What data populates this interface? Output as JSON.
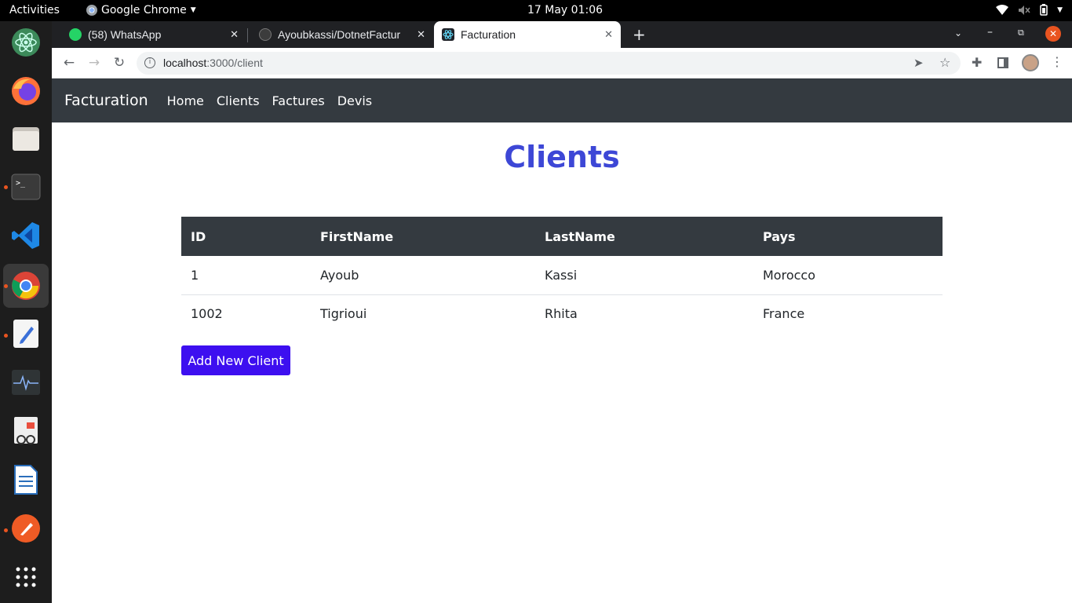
{
  "topbar": {
    "activities": "Activities",
    "app_name": "Google Chrome",
    "clock": "17 May  01:06"
  },
  "tabs": [
    {
      "title": "(58) WhatsApp",
      "favicon": "whatsapp-icon"
    },
    {
      "title": "Ayoubkassi/DotnetFactur",
      "favicon": "github-icon"
    },
    {
      "title": "Facturation",
      "favicon": "react-icon",
      "active": true
    }
  ],
  "address": {
    "host": "localhost",
    "path": ":3000/client"
  },
  "navbar": {
    "brand": "Facturation",
    "links": [
      "Home",
      "Clients",
      "Factures",
      "Devis"
    ]
  },
  "page": {
    "title": "Clients",
    "add_button": "Add New Client"
  },
  "table": {
    "headers": [
      "ID",
      "FirstName",
      "LastName",
      "Pays"
    ],
    "rows": [
      [
        "1",
        "Ayoub",
        "Kassi",
        "Morocco"
      ],
      [
        "1002",
        "Tigrioui",
        "Rhita",
        "France"
      ]
    ]
  },
  "colors": {
    "title": "#3d47d6",
    "navbar": "#343a40",
    "button": "#3d0ff0"
  }
}
